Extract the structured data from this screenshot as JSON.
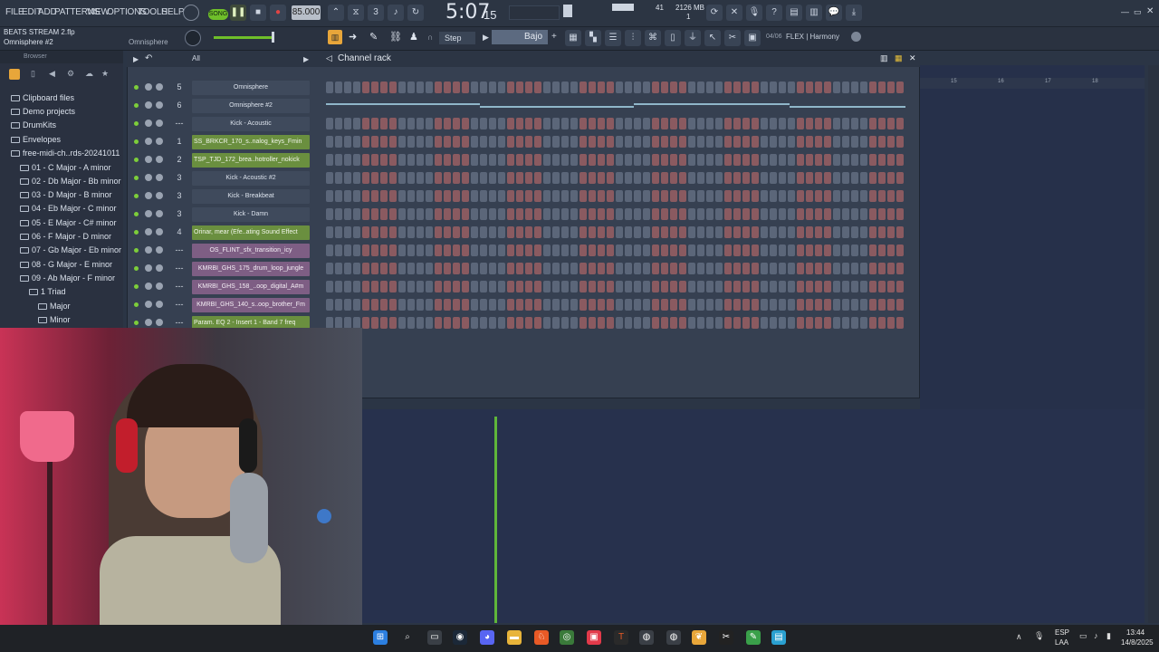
{
  "menu": {
    "file": "FILE",
    "edit": "EDIT",
    "add": "ADD",
    "patterns": "PATTERNS",
    "view": "VIEW",
    "options": "OPTIONS",
    "tools": "TOOLS",
    "help": "HELP"
  },
  "transport": {
    "song_label": "SONG",
    "tempo": "85.000",
    "time_main": "5:07",
    "time_sub": "15",
    "cpu": "41",
    "memory": "2126 MB",
    "polyphony": "1"
  },
  "project": {
    "file_name": "BEATS STREAM 2.flp",
    "channel_hint": "Omnisphere #2",
    "hint_right": "Omnisphere"
  },
  "toolbar2": {
    "step_mode": "Step",
    "snap": "Bajo",
    "pattern_info": "04/06",
    "preset": "FLEX | Harmony"
  },
  "browser": {
    "header": "Browser",
    "items": [
      "Clipboard files",
      "Demo projects",
      "DrumKits",
      "Envelopes",
      "free-midi-ch..rds-20241011",
      "01 - C Major - A minor",
      "02 - Db Major - Bb minor",
      "03 - D Major - B minor",
      "04 - Eb Major - C minor",
      "05 - E Major - C# minor",
      "06 - F Major - D minor",
      "07 - Gb Major - Eb minor",
      "08 - G Major - E minor",
      "09 - Ab Major - F minor",
      "1 Triad",
      "Major",
      "Minor"
    ]
  },
  "channel_rack": {
    "title": "Channel rack",
    "filter": "All",
    "channels": [
      {
        "num": "5",
        "name": "Omnisphere",
        "style": "plain",
        "pattern": "steps"
      },
      {
        "num": "6",
        "name": "Omnisphere #2",
        "style": "plain",
        "pattern": "notes"
      },
      {
        "num": "---",
        "name": "Kick - Acoustic",
        "style": "plain",
        "pattern": "steps"
      },
      {
        "num": "1",
        "name": "SS_BRKCR_170_s..nalog_keys_Fmin",
        "style": "green",
        "pattern": "steps"
      },
      {
        "num": "2",
        "name": "TSP_TJD_172_brea..hotroller_nokick",
        "style": "green",
        "pattern": "steps"
      },
      {
        "num": "3",
        "name": "Kick - Acoustic #2",
        "style": "plain",
        "pattern": "steps"
      },
      {
        "num": "3",
        "name": "Kick - Breakbeat",
        "style": "plain",
        "pattern": "steps"
      },
      {
        "num": "3",
        "name": "Kick - Damn",
        "style": "plain",
        "pattern": "steps"
      },
      {
        "num": "4",
        "name": "Orinar, mear (Efe..ating Sound Effect",
        "style": "green",
        "pattern": "steps"
      },
      {
        "num": "---",
        "name": "OS_FLINT_sfx_transition_icy",
        "style": "purple",
        "pattern": "steps"
      },
      {
        "num": "---",
        "name": "KMRBI_GHS_175_drum_loop_jungle",
        "style": "purple",
        "pattern": "steps"
      },
      {
        "num": "---",
        "name": "KMRBI_GHS_158_..oop_digital_A#m",
        "style": "purple",
        "pattern": "steps"
      },
      {
        "num": "---",
        "name": "KMRBI_GHS_140_s..oop_brother_Fm",
        "style": "purple",
        "pattern": "steps"
      },
      {
        "num": "---",
        "name": "Param. EQ 2 - Insert 1 - Band 7 freq",
        "style": "green",
        "pattern": "steps"
      }
    ]
  },
  "playlist": {
    "ruler": [
      "15",
      "16",
      "17",
      "18"
    ]
  },
  "taskbar": {
    "lang_top": "ESP",
    "lang_bottom": "LAA",
    "time": "13:44",
    "date": "14/8/2025"
  }
}
